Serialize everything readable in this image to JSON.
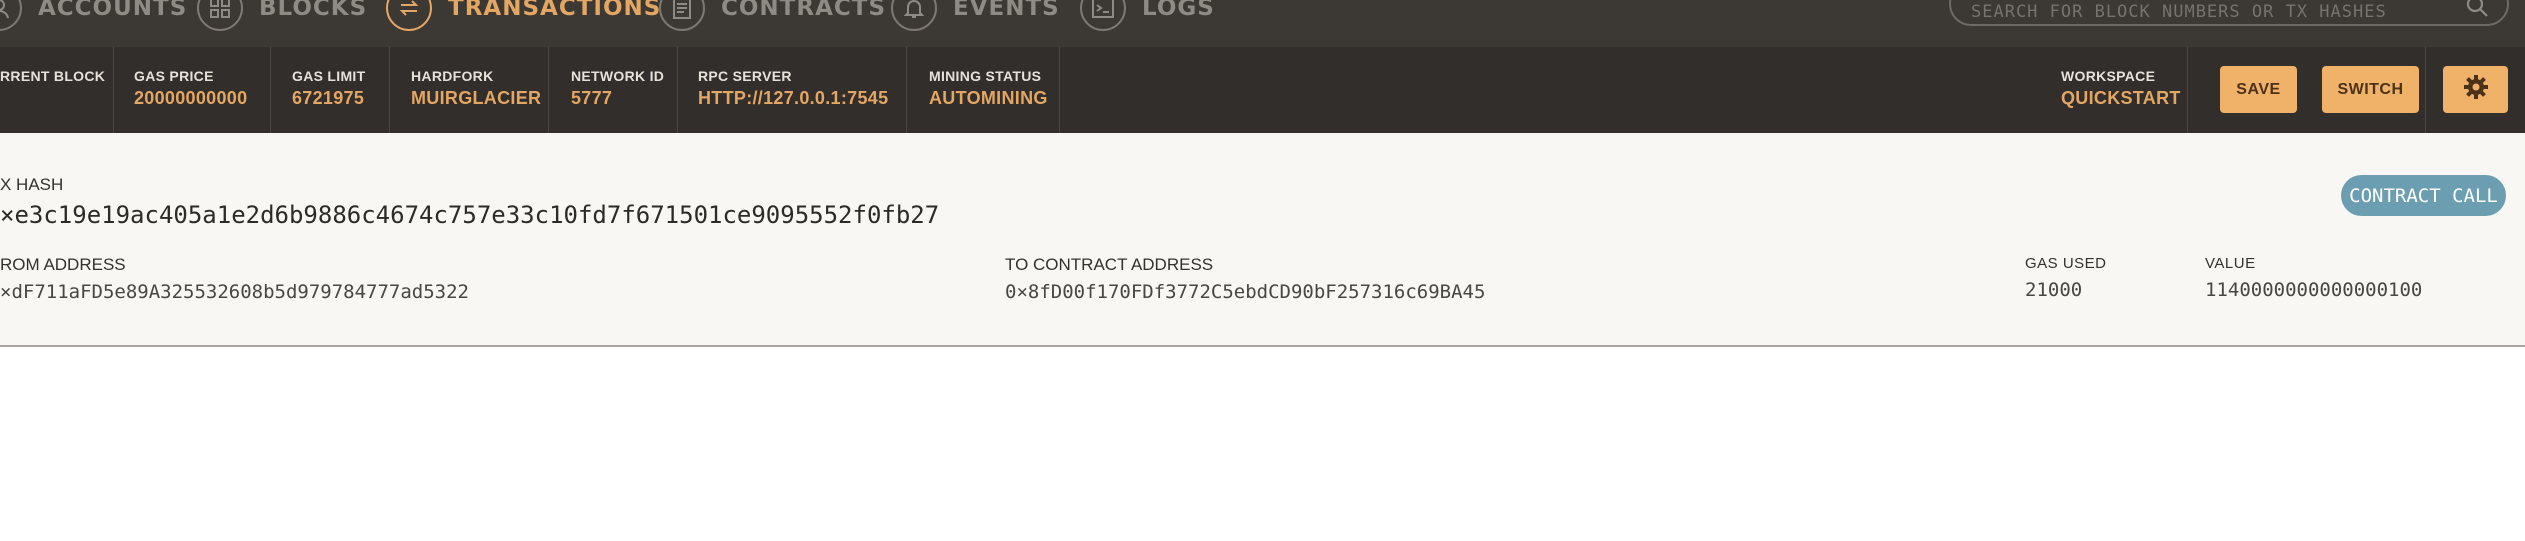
{
  "nav": {
    "items": [
      {
        "label": "ACCOUNTS",
        "icon": "accounts-icon"
      },
      {
        "label": "BLOCKS",
        "icon": "blocks-icon"
      },
      {
        "label": "TRANSACTIONS",
        "icon": "transactions-icon",
        "active": true
      },
      {
        "label": "CONTRACTS",
        "icon": "contracts-icon"
      },
      {
        "label": "EVENTS",
        "icon": "events-icon"
      },
      {
        "label": "LOGS",
        "icon": "logs-icon"
      }
    ],
    "search_placeholder": "SEARCH FOR BLOCK NUMBERS OR TX HASHES"
  },
  "status": {
    "current_block_label": "RRENT BLOCK",
    "gas_price_label": "GAS PRICE",
    "gas_price": "20000000000",
    "gas_limit_label": "GAS LIMIT",
    "gas_limit": "6721975",
    "hardfork_label": "HARDFORK",
    "hardfork": "MUIRGLACIER",
    "network_id_label": "NETWORK ID",
    "network_id": "5777",
    "rpc_server_label": "RPC SERVER",
    "rpc_server": "HTTP://127.0.0.1:7545",
    "mining_status_label": "MINING STATUS",
    "mining_status": "AUTOMINING",
    "workspace_label": "WORKSPACE",
    "workspace": "QUICKSTART",
    "save_label": "SAVE",
    "switch_label": "SWITCH",
    "settings_icon": "gear-icon"
  },
  "transaction": {
    "hash_label": "X HASH",
    "hash": "×e3c19e19ac405a1e2d6b9886c4674c757e33c10fd7f671501ce9095552f0fb27",
    "type_badge": "CONTRACT CALL",
    "from_label": "ROM ADDRESS",
    "from": "×dF711aFD5e89A325532608b5d979784777ad5322",
    "to_label": "TO CONTRACT ADDRESS",
    "to": "0×8fD00f170FDf3772C5ebdCD90bF257316c69BA45",
    "gas_used_label": "GAS USED",
    "gas_used": "21000",
    "value_label": "VALUE",
    "value": "1140000000000000100"
  },
  "colors": {
    "nav_bg": "#3c3935",
    "status_bg": "#322e2b",
    "accent": "#e4a663",
    "button": "#efb268",
    "badge": "#6b9eb0",
    "detail_bg": "#f8f7f3"
  }
}
